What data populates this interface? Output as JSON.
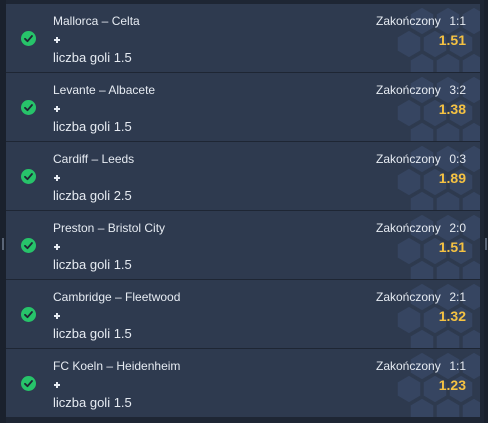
{
  "bets": [
    {
      "match": "Mallorca – Celta",
      "status": "Zakończony",
      "score": "1:1",
      "market": "liczba goli 1.5",
      "odds": "1.51"
    },
    {
      "match": "Levante – Albacete",
      "status": "Zakończony",
      "score": "3:2",
      "market": "liczba goli 1.5",
      "odds": "1.38"
    },
    {
      "match": "Cardiff – Leeds",
      "status": "Zakończony",
      "score": "0:3",
      "market": "liczba goli 2.5",
      "odds": "1.89"
    },
    {
      "match": "Preston – Bristol City",
      "status": "Zakończony",
      "score": "2:0",
      "market": "liczba goli 1.5",
      "odds": "1.51"
    },
    {
      "match": "Cambridge – Fleetwood",
      "status": "Zakończony",
      "score": "2:1",
      "market": "liczba goli 1.5",
      "odds": "1.32"
    },
    {
      "match": "FC Koeln – Heidenheim",
      "status": "Zakończony",
      "score": "1:1",
      "market": "liczba goli 1.5",
      "odds": "1.23"
    }
  ],
  "icons": {
    "status": "check-circle-icon",
    "selection": "plus-icon",
    "background": "football-pattern-icon"
  },
  "colors": {
    "row": "#2e3a4f",
    "won": "#27c36a",
    "odds": "#f5c242",
    "text": "#e6ebf2"
  }
}
